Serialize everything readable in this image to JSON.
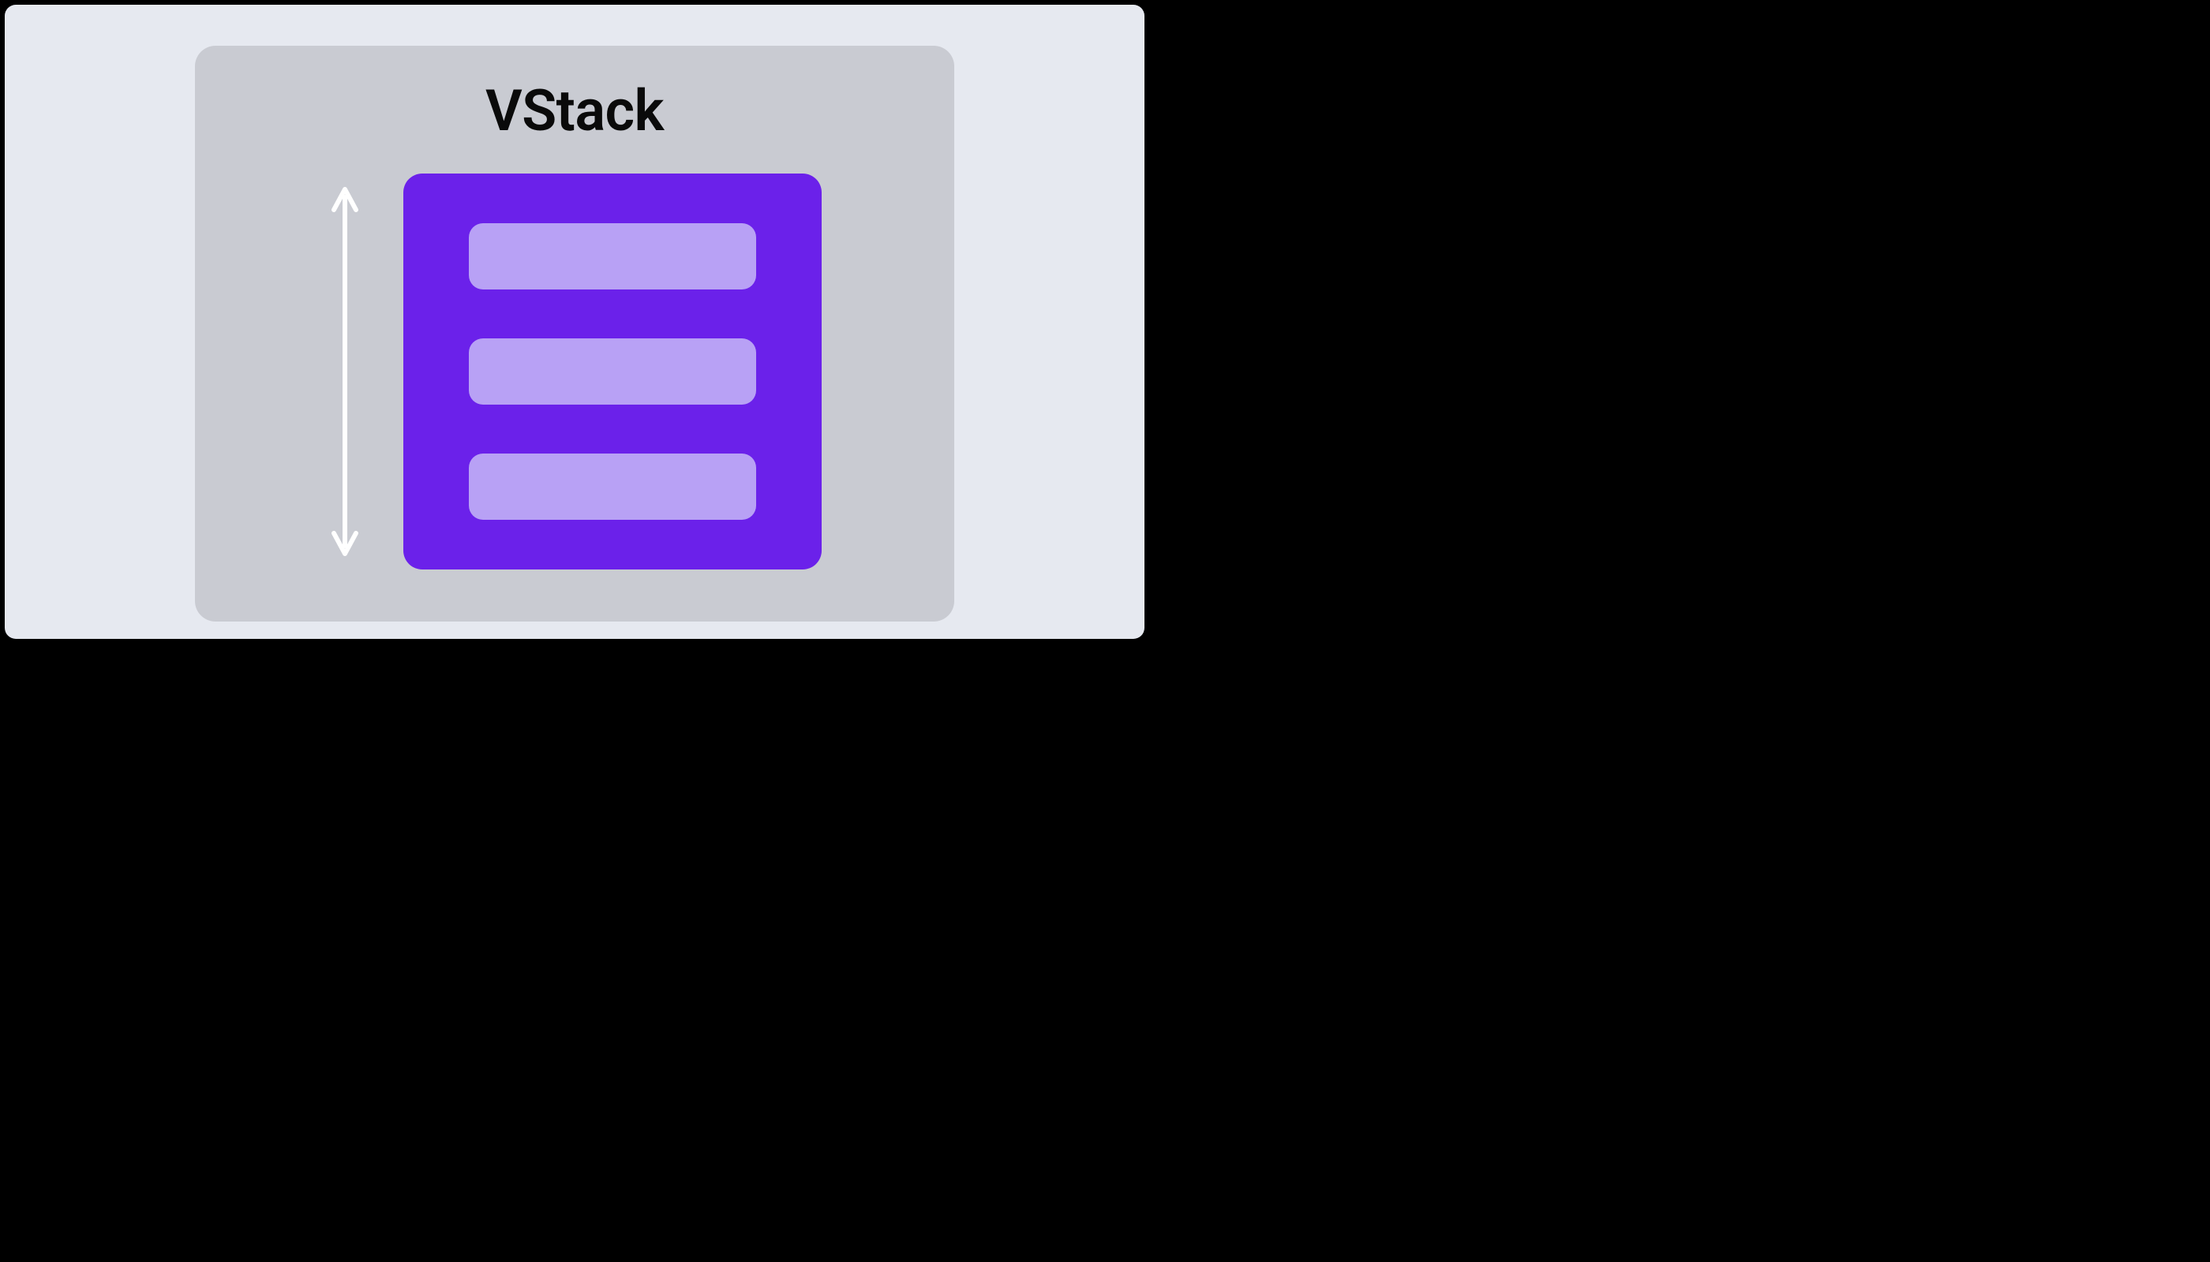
{
  "diagram": {
    "title": "VStack",
    "container_color": "#6B21EA",
    "item_color": "#B8A1F5",
    "arrow_color": "#FFFFFF",
    "card_bg": "#C9CBD2",
    "outer_bg": "#E6E9F0",
    "item_count": 3
  }
}
